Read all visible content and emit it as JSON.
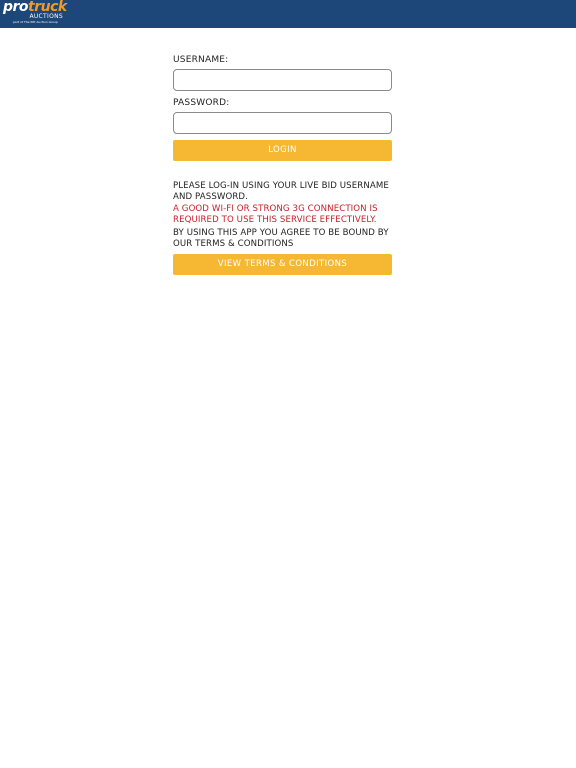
{
  "header": {
    "logo_pro": "pro",
    "logo_truck": "truck",
    "logo_sub": "AUCTIONS",
    "logo_tag": "part of The Pitt Auction Group"
  },
  "form": {
    "username_label": "USERNAME:",
    "username_value": "",
    "password_label": "PASSWORD:",
    "password_value": "",
    "login_label": "LOGIN"
  },
  "info": {
    "instructions": "PLEASE LOG-IN USING YOUR LIVE BID USERNAME AND PASSWORD.",
    "warning": "A GOOD WI-FI OR STRONG 3G CONNECTION IS REQUIRED TO USE THIS SERVICE EFFECTIVELY.",
    "agreement": "BY USING THIS APP YOU AGREE TO BE BOUND BY OUR TERMS & CONDITIONS",
    "terms_button_label": "VIEW TERMS & CONDITIONS"
  },
  "colors": {
    "header_bg": "#1d4679",
    "accent": "#f6b832",
    "logo_orange": "#f39a26",
    "warning_text": "#c5202a"
  }
}
